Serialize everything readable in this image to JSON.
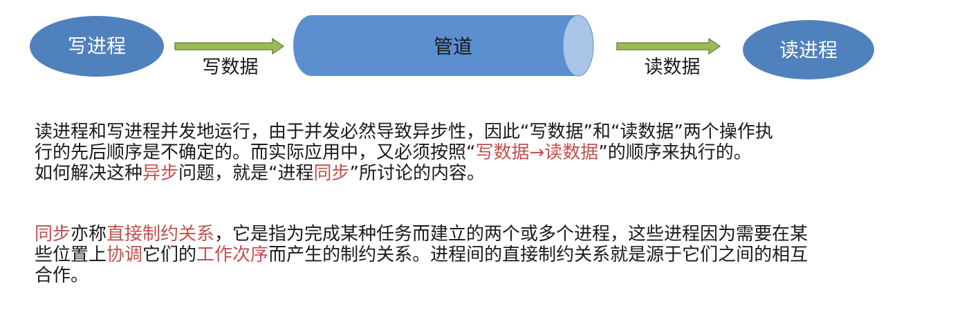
{
  "diagram": {
    "write_process": "写进程",
    "write_data": "写数据",
    "pipe": "管道",
    "read_data": "读数据",
    "read_process": "读进程",
    "colors": {
      "ellipse_fill": "#4f81bd",
      "pipe_fill": "#5b8fcf",
      "pipe_end": "#a9c4e6",
      "arrow_fill": "#9bbb59",
      "arrow_stroke": "#71893f",
      "node_text": "#ffffff",
      "highlight": "#c0504d"
    }
  },
  "paragraph1": {
    "line1": "读进程和写进程并发地运行，由于并发必然导致异步性，因此“写数据”和“读数据”两个操作执",
    "line2_a": "行的先后顺序是不确定的。而实际应用中，又必须按照“",
    "line2_hl1": "写数据",
    "line2_arrow": "→",
    "line2_hl2": "读数据",
    "line2_b": "”的顺序来执行的。",
    "line3_a": "如何解决这种",
    "line3_hl1": "异步",
    "line3_b": "问题，就是“进程",
    "line3_hl2": "同步",
    "line3_c": "”所讨论的内容。"
  },
  "paragraph2": {
    "hl1": "同步",
    "t1": "亦称",
    "hl2": "直接制约关系",
    "t2": "，它是指为完成某种任务而建立的两个或多个进程，这些进程因为需要在某",
    "t3": "些位置上",
    "hl3": "协调",
    "t4": "它们的",
    "hl4": "工作次序",
    "t5": "而产生的制约关系。进程间的直接制约关系就是源于它们之间的相互",
    "t6": "合作。"
  }
}
